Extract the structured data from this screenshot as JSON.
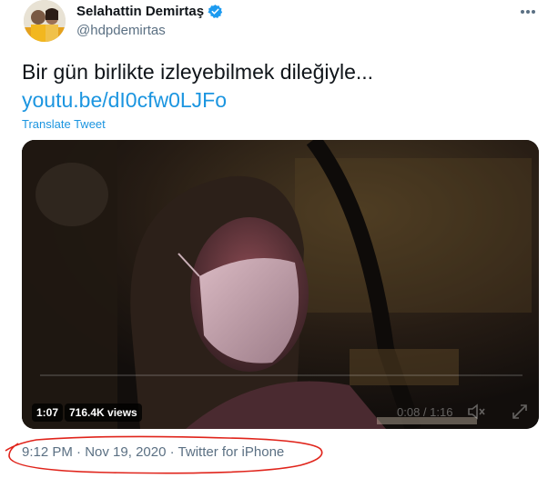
{
  "author": {
    "name": "Selahattin Demirtaş",
    "handle": "@hdpdemirtas",
    "verified": true,
    "avatar_icon": "profile-photo"
  },
  "tweet": {
    "text": "Bir gün birlikte izleyebilmek dileğiyle...",
    "link": "youtu.be/dI0cfw0LJFo",
    "translate_label": "Translate Tweet"
  },
  "video": {
    "duration": "1:07",
    "views": "716.4K views",
    "time_display": "0:08 / 1:16"
  },
  "meta": {
    "time": "9:12 PM",
    "separator": "·",
    "date": "Nov 19, 2020",
    "source": "Twitter for iPhone"
  },
  "colors": {
    "link": "#1b95e0",
    "secondary_text": "#5b7083",
    "annotation": "#e0241b"
  }
}
